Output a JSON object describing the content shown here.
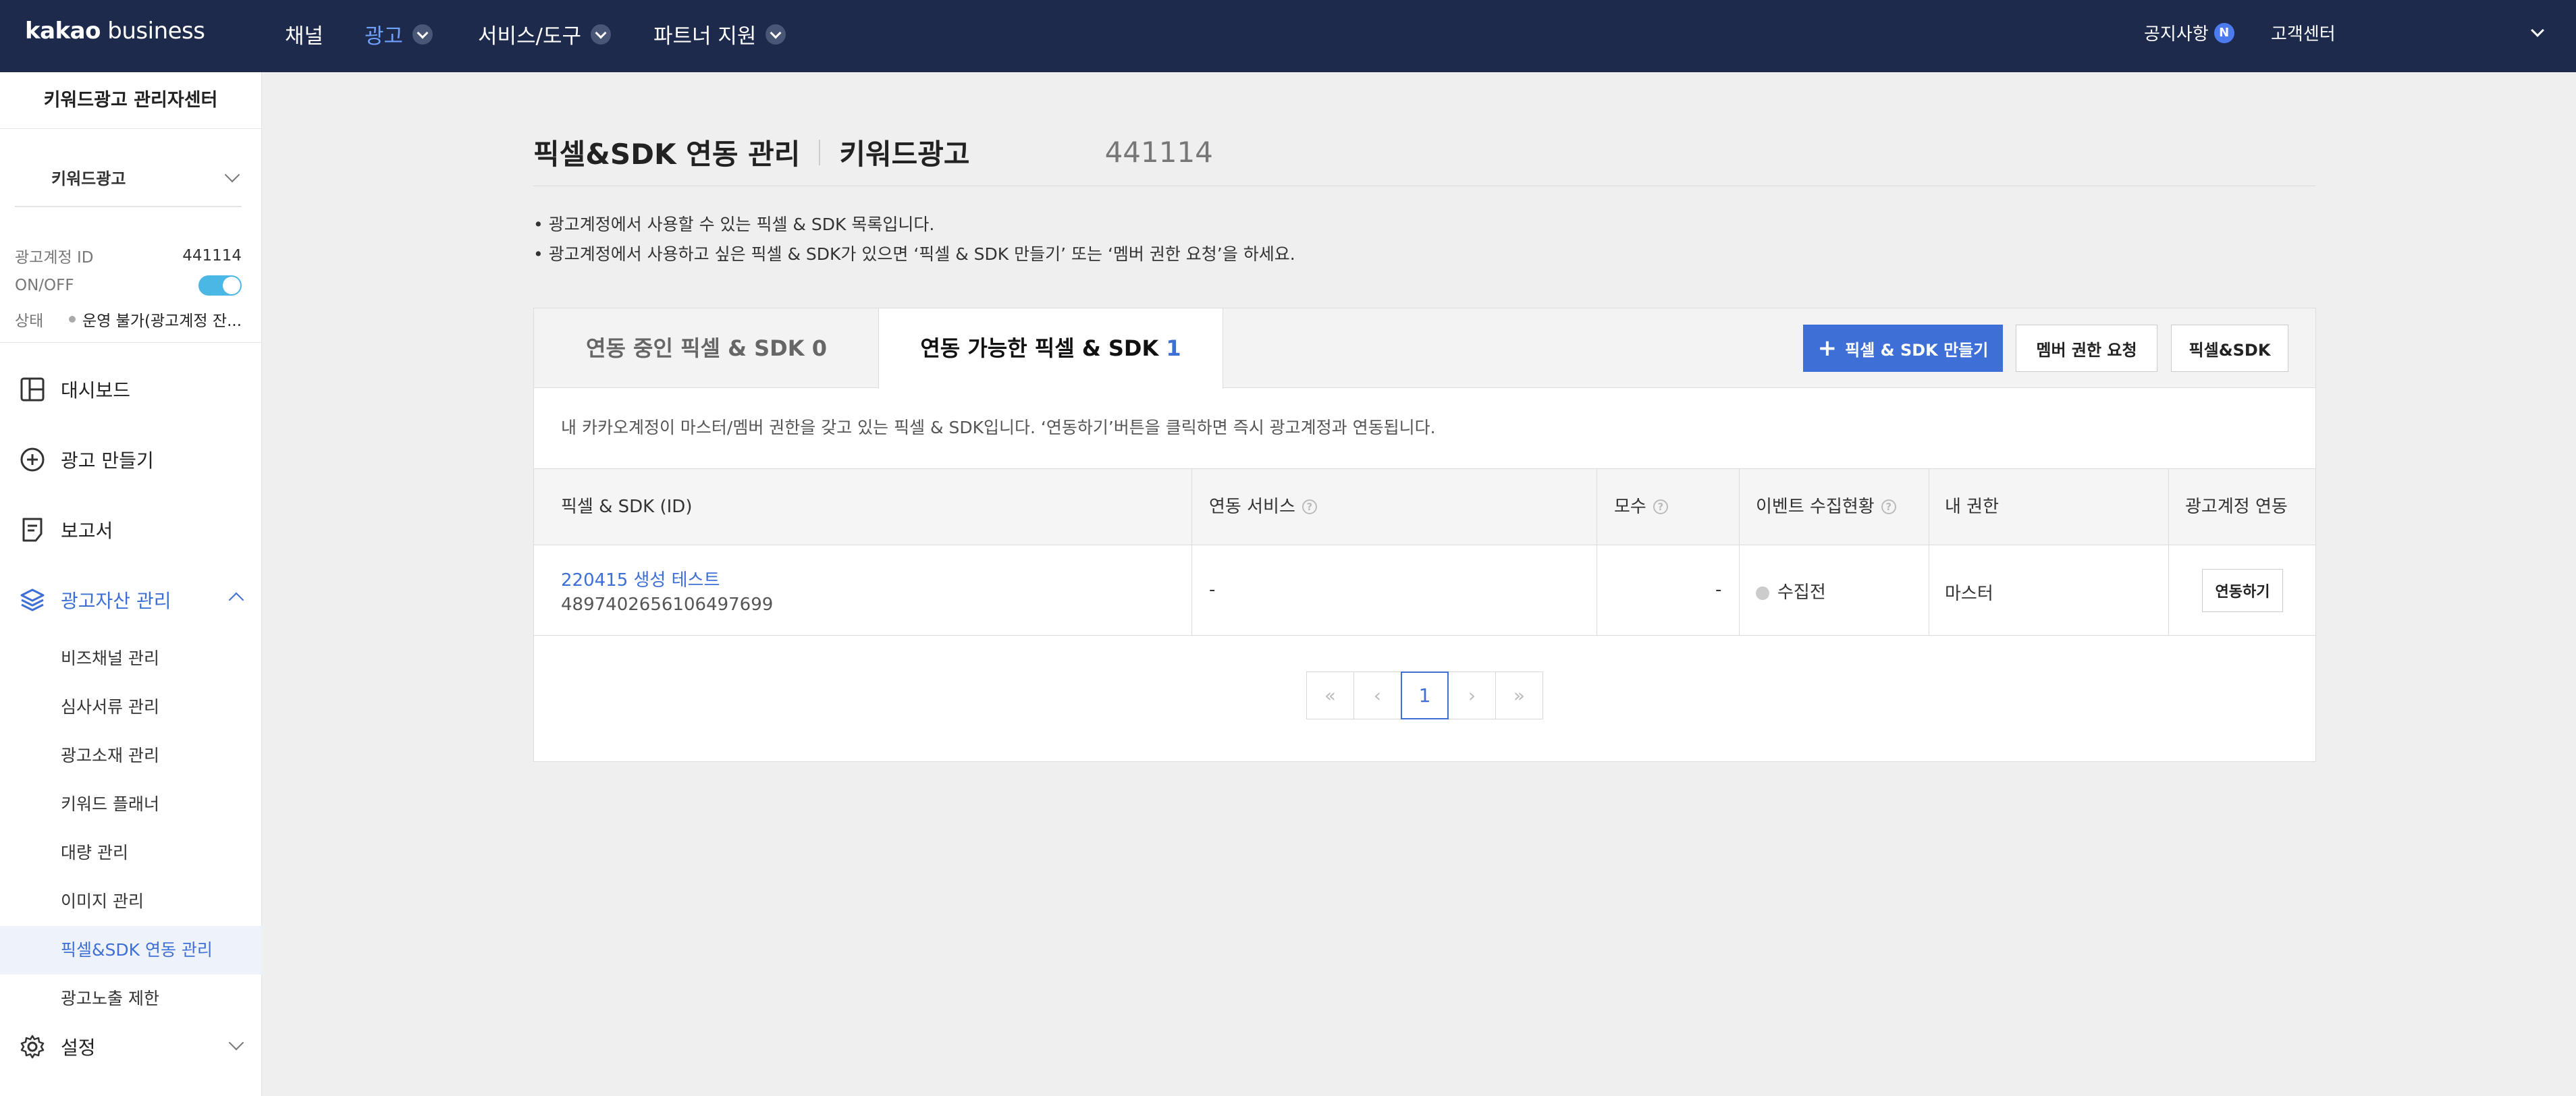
{
  "topnav": {
    "logo_bold": "kakao",
    "logo_rest": " business",
    "items": [
      {
        "label": "채널"
      },
      {
        "label": "광고"
      },
      {
        "label": "서비스/도구"
      },
      {
        "label": "파트너 지원"
      }
    ],
    "notice": "공지사항",
    "notice_badge": "N",
    "customer_center": "고객센터"
  },
  "sidebar": {
    "title": "키워드광고 관리자센터",
    "account_select": "키워드광고",
    "account_id_label": "광고계정 ID",
    "account_id": "441114",
    "onoff_label": "ON/OFF",
    "status_label": "상태",
    "status_value": "운영 불가(광고계정 잔...",
    "menu": [
      {
        "label": "대시보드"
      },
      {
        "label": "광고 만들기"
      },
      {
        "label": "보고서"
      },
      {
        "label": "광고자산 관리"
      }
    ],
    "sub_menu": [
      {
        "label": "비즈채널 관리"
      },
      {
        "label": "심사서류 관리"
      },
      {
        "label": "광고소재 관리"
      },
      {
        "label": "키워드 플래너"
      },
      {
        "label": "대량 관리"
      },
      {
        "label": "이미지 관리"
      },
      {
        "label": "픽셀&SDK 연동 관리"
      },
      {
        "label": "광고노출 제한"
      }
    ],
    "settings": "설정"
  },
  "main": {
    "title": "픽셀&SDK 연동 관리",
    "subtitle": "키워드광고",
    "account_id": "441114",
    "desc_1": "• 광고계정에서 사용할 수 있는 픽셀 & SDK 목록입니다.",
    "desc_2": "• 광고계정에서 사용하고 싶은 픽셀 & SDK가 있으면 ‘픽셀 & SDK 만들기’ 또는 ‘멤버 권한 요청’을 하세요.",
    "tabs": [
      {
        "label": "연동 중인 픽셀 & SDK",
        "count": "0"
      },
      {
        "label": "연동 가능한 픽셀 & SDK",
        "count": "1"
      }
    ],
    "buttons": {
      "create": "픽셀 & SDK 만들기",
      "member_request": "멤버 권한 요청",
      "pixel_sdk": "픽셀&SDK"
    },
    "panel_desc": "내 카카오계정이 마스터/멤버 권한을 갖고 있는 픽셀 & SDK입니다. ‘연동하기’버튼을 클릭하면 즉시 광고계정과 연동됩니다.",
    "table": {
      "headers": [
        "픽셀 & SDK (ID)",
        "연동 서비스",
        "모수",
        "이벤트 수집현황",
        "내 권한",
        "광고계정 연동"
      ],
      "rows": [
        {
          "name": "220415 생성 테스트",
          "id": "4897402656106497699",
          "service": "-",
          "population": "-",
          "event_status": "수집전",
          "permission": "마스터",
          "action": "연동하기"
        }
      ]
    },
    "pagination": {
      "first": "«",
      "prev": "‹",
      "current": "1",
      "next": "›",
      "last": "»"
    }
  },
  "colors": {
    "nav_bg": "#1d2a4b",
    "accent": "#3d6fd6",
    "nav_active": "#6fa1ff",
    "toggle_on": "#4ab7e5"
  }
}
